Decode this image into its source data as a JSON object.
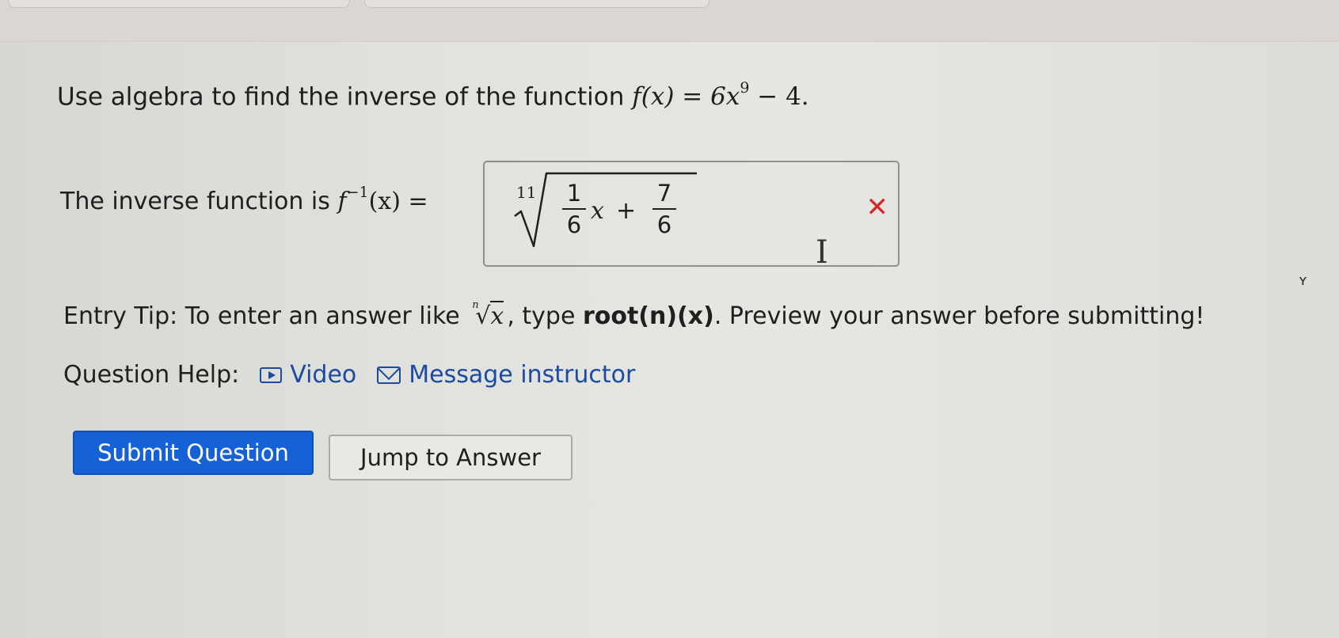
{
  "question": {
    "lead_text": "Use algebra to find the inverse of the function",
    "function_lhs": "f(x) = 6x",
    "exponent": "9",
    "function_tail": " − 4."
  },
  "answer": {
    "label_text": "The inverse function is",
    "lhs_f": "f",
    "lhs_exponent": "−1",
    "lhs_rest": "(x) =",
    "root_index": "11",
    "frac1_num": "1",
    "frac1_den": "6",
    "variable": "x",
    "plus": "+",
    "frac2_num": "7",
    "frac2_den": "6",
    "status_icon_glyph": "✕",
    "status_color": "#d22a2a"
  },
  "entry_tip": {
    "prefix": "Entry Tip: To enter an answer like",
    "root_index": "n",
    "root_arg": "x",
    "middle": ", type ",
    "syntax": "root(n)(x)",
    "suffix": ". Preview your answer before submitting!"
  },
  "help": {
    "label": "Question Help:",
    "video_label": "Video",
    "message_label": "Message instructor",
    "link_color": "#1b4aa3"
  },
  "buttons": {
    "submit_label": "Submit Question",
    "submit_color": "#1761d6",
    "jump_label": "Jump to Answer"
  },
  "stray_mark": "ʏ"
}
